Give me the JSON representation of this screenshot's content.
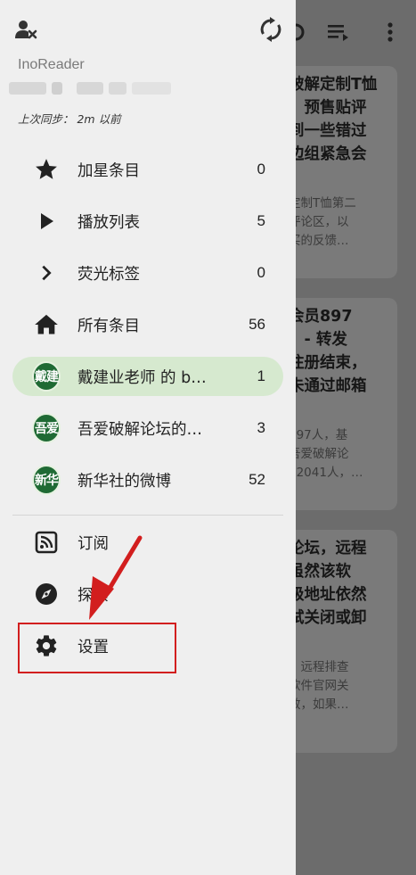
{
  "app": {
    "name": "InoReader",
    "sync_status": "上次同步： 2m 以前"
  },
  "header_icons": {
    "account": "account-icon",
    "sync": "sync-icon"
  },
  "background": {
    "toolbar_icons": [
      "mark-read-icon",
      "sort-list-icon",
      "more-vert-icon"
    ],
    "cards": [
      {
        "title": "破解定制T恤\n，预售贴评\n到一些错过\n边组紧急会",
        "snippet": "定制T恤第二\n评论区，以\n买的反馈…"
      },
      {
        "title": "会员897\n。- 转发\n注册结束，\n未通过邮箱",
        "snippet": "897人，基\n吾爱破解论\n32041人，…"
      },
      {
        "title": "论坛，远程\n虽然该软\n级地址依然\n试关闭或卸",
        "snippet": "，远程排查\n软件官网关\n效，如果…"
      }
    ]
  },
  "nav": {
    "items": [
      {
        "label": "加星条目",
        "count": "0",
        "icon": "star-icon"
      },
      {
        "label": "播放列表",
        "count": "5",
        "icon": "play-icon"
      },
      {
        "label": "荧光标签",
        "count": "0",
        "icon": "chevron-right-icon"
      },
      {
        "label": "所有条目",
        "count": "56",
        "icon": "home-icon"
      },
      {
        "label": "戴建业老师 的 b…",
        "count": "1",
        "badge": "戴建",
        "active": true
      },
      {
        "label": "吾爱破解论坛的…",
        "count": "3",
        "badge": "吾爱"
      },
      {
        "label": "新华社的微博",
        "count": "52",
        "badge": "新华"
      }
    ],
    "secondary": [
      {
        "label": "订阅",
        "icon": "rss-feed-icon"
      },
      {
        "label": "探索",
        "icon": "compass-icon"
      },
      {
        "label": "设置",
        "icon": "gear-icon"
      }
    ]
  },
  "colors": {
    "drawer_bg": "#efefef",
    "active_item_bg": "#d6e9cf",
    "badge_green": "#1f6a34",
    "annotation_red": "#d21e1e",
    "scrim": "#6c6c6c"
  }
}
